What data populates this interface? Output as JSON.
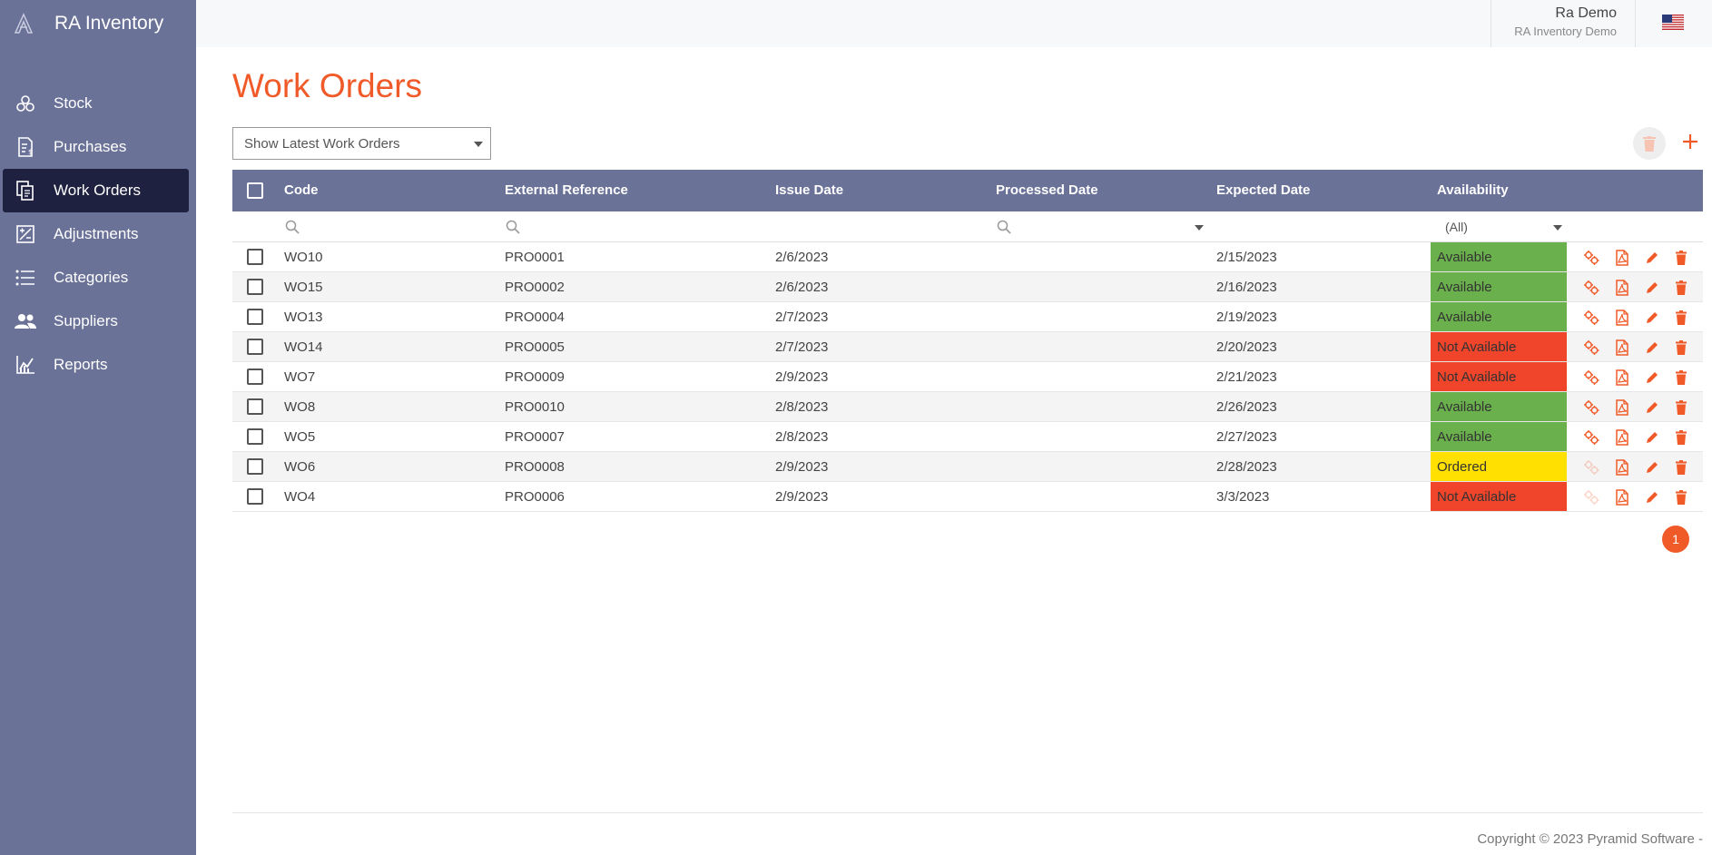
{
  "app": {
    "name": "RA Inventory"
  },
  "sidebar": {
    "items": [
      {
        "label": "Stock",
        "icon": "stock-icon"
      },
      {
        "label": "Purchases",
        "icon": "purchases-icon"
      },
      {
        "label": "Work Orders",
        "icon": "work-orders-icon",
        "active": true
      },
      {
        "label": "Adjustments",
        "icon": "adjustments-icon"
      },
      {
        "label": "Categories",
        "icon": "categories-icon"
      },
      {
        "label": "Suppliers",
        "icon": "suppliers-icon"
      },
      {
        "label": "Reports",
        "icon": "reports-icon"
      }
    ]
  },
  "user": {
    "name": "Ra Demo",
    "org": "RA Inventory Demo",
    "locale_flag": "us-flag-icon"
  },
  "page": {
    "title": "Work Orders",
    "filter_value": "Show Latest Work Orders"
  },
  "table": {
    "columns": [
      "Code",
      "External Reference",
      "Issue Date",
      "Processed Date",
      "Expected Date",
      "Availability"
    ],
    "availability_filter": "(All)",
    "rows": [
      {
        "code": "WO10",
        "ext_ref": "PRO0001",
        "issue": "2/6/2023",
        "processed": "",
        "expected": "2/15/2023",
        "availability": "Available"
      },
      {
        "code": "WO15",
        "ext_ref": "PRO0002",
        "issue": "2/6/2023",
        "processed": "",
        "expected": "2/16/2023",
        "availability": "Available"
      },
      {
        "code": "WO13",
        "ext_ref": "PRO0004",
        "issue": "2/7/2023",
        "processed": "",
        "expected": "2/19/2023",
        "availability": "Available"
      },
      {
        "code": "WO14",
        "ext_ref": "PRO0005",
        "issue": "2/7/2023",
        "processed": "",
        "expected": "2/20/2023",
        "availability": "Not Available"
      },
      {
        "code": "WO7",
        "ext_ref": "PRO0009",
        "issue": "2/9/2023",
        "processed": "",
        "expected": "2/21/2023",
        "availability": "Not Available"
      },
      {
        "code": "WO8",
        "ext_ref": "PRO0010",
        "issue": "2/8/2023",
        "processed": "",
        "expected": "2/26/2023",
        "availability": "Available"
      },
      {
        "code": "WO5",
        "ext_ref": "PRO0007",
        "issue": "2/8/2023",
        "processed": "",
        "expected": "2/27/2023",
        "availability": "Available"
      },
      {
        "code": "WO6",
        "ext_ref": "PRO0008",
        "issue": "2/9/2023",
        "processed": "",
        "expected": "2/28/2023",
        "availability": "Ordered"
      },
      {
        "code": "WO4",
        "ext_ref": "PRO0006",
        "issue": "2/9/2023",
        "processed": "",
        "expected": "3/3/2023",
        "availability": "Not Available"
      }
    ]
  },
  "pagination": {
    "current_page": "1"
  },
  "footer": {
    "copyright": "Copyright © 2023 Pyramid Software -"
  },
  "colors": {
    "sidebar_bg": "#6b7298",
    "accent": "#f05a28",
    "available": "#6ab04c",
    "not_available": "#f0452b",
    "ordered": "#ffe000"
  }
}
